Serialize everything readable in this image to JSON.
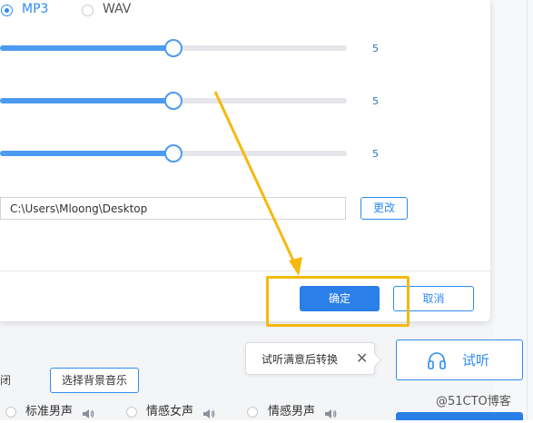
{
  "format": {
    "options": [
      {
        "label": "MP3",
        "checked": true
      },
      {
        "label": "WAV",
        "checked": false
      }
    ]
  },
  "sliders": [
    {
      "value_label": "5",
      "level_fraction": 0.5
    },
    {
      "value_label": "5",
      "level_fraction": 0.5
    },
    {
      "value_label": "5",
      "level_fraction": 0.5
    }
  ],
  "save_path": {
    "value": "C:\\Users\\Mloong\\Desktop",
    "change_label": "更改"
  },
  "dialog": {
    "ok_label": "确定",
    "cancel_label": "取消"
  },
  "tooltip": {
    "text": "试听满意后转换",
    "close_glyph": "✕"
  },
  "listen_button": {
    "label": "试听"
  },
  "bottom": {
    "closed_label": "闭",
    "bgm_button_label": "选择背景音乐",
    "voices": [
      "标准男声",
      "情感女声",
      "情感男声"
    ]
  },
  "watermark": "@51CTO博客",
  "colors": {
    "accent": "#2f8cf0",
    "primary_button": "#2a7fe9",
    "highlight": "#f5b90f"
  },
  "icons": {
    "listen": "headphones-icon",
    "voice": "speaker-icon",
    "tooltip_close": "close-icon"
  }
}
